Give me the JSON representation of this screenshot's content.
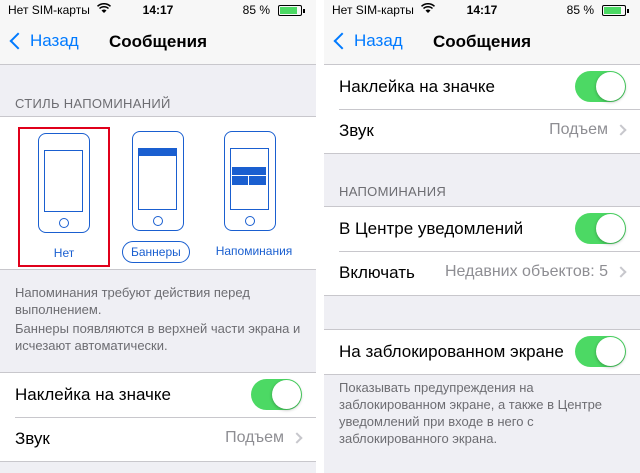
{
  "status": {
    "carrier": "Нет SIM-карты",
    "wifi_icon": "wifi-icon",
    "time": "14:17",
    "battery": "85 %",
    "battery_level": 0.85
  },
  "left": {
    "nav": {
      "back_label": "Назад",
      "title": "Сообщения"
    },
    "alert_style_header": "СТИЛЬ НАПОМИНАНИЙ",
    "styles": [
      {
        "label": "Нет",
        "selected": true
      },
      {
        "label": "Баннеры",
        "selected": false
      },
      {
        "label": "Напоминания",
        "selected": false
      }
    ],
    "footer_1": "Напоминания требуют действия перед выполнением.",
    "footer_2": "Баннеры появляются в верхней части экрана и исчезают автоматически.",
    "badge_label": "Наклейка на значке",
    "badge_on": true,
    "sound_label": "Звук",
    "sound_value": "Подъем"
  },
  "right": {
    "nav": {
      "back_label": "Назад",
      "title": "Сообщения"
    },
    "badge_label": "Наклейка на значке",
    "badge_on": true,
    "sound_label": "Звук",
    "sound_value": "Подъем",
    "alerts_header": "НАПОМИНАНИЯ",
    "nc_label": "В Центре уведомлений",
    "nc_on": true,
    "include_label": "Включать",
    "include_value": "Недавних объектов: 5",
    "lock_label": "На заблокированном экране",
    "lock_on": true,
    "lock_footer": "Показывать предупреждения на заблокированном экране, а также в Центре уведомлений при входе в него с заблокированного экрана."
  },
  "colors": {
    "accent": "#007aff",
    "switch_on": "#4cd964",
    "selection": "#e0001b",
    "illustration": "#1a5fd0"
  }
}
